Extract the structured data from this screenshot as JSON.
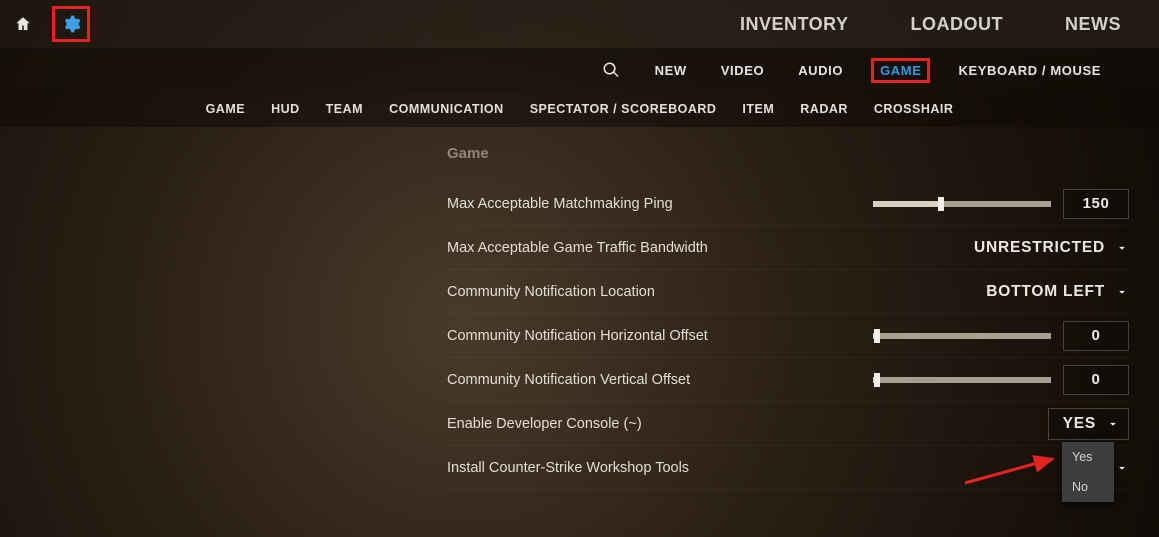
{
  "topnav": {
    "items": [
      "INVENTORY",
      "LOADOUT",
      "NEWS"
    ]
  },
  "tabs1": {
    "items": [
      "NEW",
      "VIDEO",
      "AUDIO",
      "GAME",
      "KEYBOARD / MOUSE"
    ],
    "active_index": 3
  },
  "tabs2": {
    "items": [
      "GAME",
      "HUD",
      "TEAM",
      "COMMUNICATION",
      "SPECTATOR / SCOREBOARD",
      "ITEM",
      "RADAR",
      "CROSSHAIR"
    ]
  },
  "settings": {
    "section_title": "Game",
    "rows": {
      "ping": {
        "label": "Max Acceptable Matchmaking Ping",
        "value": "150",
        "fill_pct": 38
      },
      "bandwidth": {
        "label": "Max Acceptable Game Traffic Bandwidth",
        "value": "UNRESTRICTED"
      },
      "notif_loc": {
        "label": "Community Notification Location",
        "value": "BOTTOM LEFT"
      },
      "notif_h": {
        "label": "Community Notification Horizontal Offset",
        "value": "0",
        "fill_pct": 2
      },
      "notif_v": {
        "label": "Community Notification Vertical Offset",
        "value": "0",
        "fill_pct": 2
      },
      "devcon": {
        "label": "Enable Developer Console (~)",
        "value": "YES"
      },
      "workshop": {
        "label": "Install Counter-Strike Workshop Tools"
      }
    },
    "dropdown_options": [
      "Yes",
      "No"
    ]
  }
}
